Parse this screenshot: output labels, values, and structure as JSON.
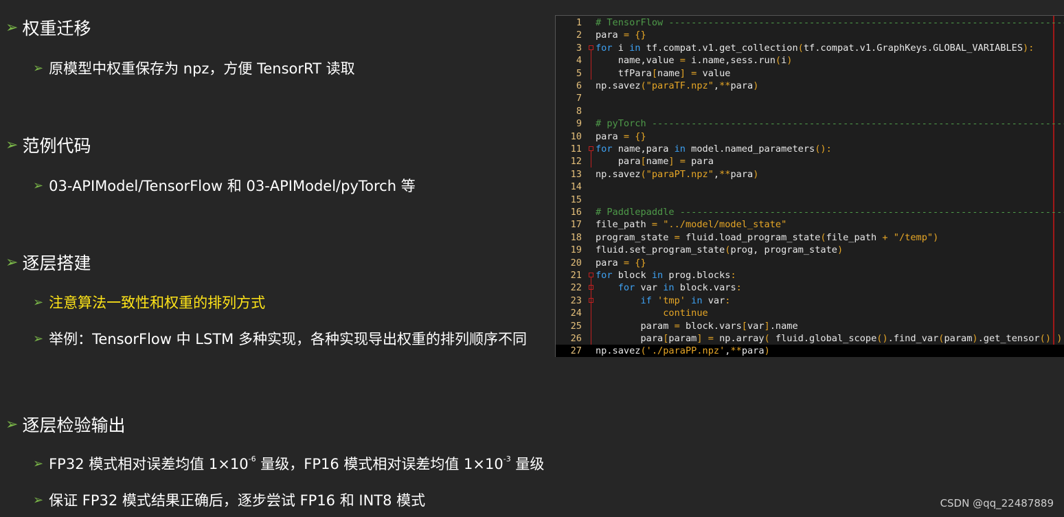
{
  "slide": {
    "sections": [
      {
        "title": "权重迁移",
        "items": [
          {
            "text": "原模型中权重保存为 npz，方便 TensorRT 读取"
          }
        ]
      },
      {
        "title": "范例代码",
        "items": [
          {
            "text": "03-APIModel/TensorFlow 和 03-APIModel/pyTorch 等"
          }
        ]
      },
      {
        "title": "逐层搭建",
        "items": [
          {
            "text": "注意算法一致性和权重的排列方式",
            "color": "#ffe418"
          },
          {
            "text": "举例：TensorFlow 中 LSTM 多种实现，各种实现导出权重的排列顺序不同"
          }
        ]
      },
      {
        "title": "逐层检验输出",
        "items": [
          {
            "parts": [
              "FP32 模式相对误差均值 1×10",
              "-6",
              " 量级，FP16 模式相对误差均值 1×10",
              "-3",
              " 量级"
            ]
          },
          {
            "text": "保证 FP32 模式结果正确后，逐步尝试 FP16 和 INT8 模式"
          }
        ]
      }
    ],
    "bullet_color": "#7ab648",
    "highlight_color": "#ffe418"
  },
  "code": {
    "lines": [
      {
        "n": "1",
        "src": "# TensorFlow -------------------------------------------------------------------------------"
      },
      {
        "n": "2",
        "src": "para = {}"
      },
      {
        "n": "3",
        "src": "for i in tf.compat.v1.get_collection(tf.compat.v1.GraphKeys.GLOBAL_VARIABLES):"
      },
      {
        "n": "4",
        "src": "    name,value = i.name,sess.run(i)"
      },
      {
        "n": "5",
        "src": "    tfPara[name] = value"
      },
      {
        "n": "6",
        "src": "np.savez(\"paraTF.npz\",**para)"
      },
      {
        "n": "7",
        "src": ""
      },
      {
        "n": "8",
        "src": ""
      },
      {
        "n": "9",
        "src": "# pyTorch ----------------------------------------------------------------------------------"
      },
      {
        "n": "10",
        "src": "para = {}"
      },
      {
        "n": "11",
        "src": "for name,para in model.named_parameters():"
      },
      {
        "n": "12",
        "src": "    para[name] = para"
      },
      {
        "n": "13",
        "src": "np.savez(\"paraPT.npz\",**para)"
      },
      {
        "n": "14",
        "src": ""
      },
      {
        "n": "15",
        "src": ""
      },
      {
        "n": "16",
        "src": "# Paddlepaddle -----------------------------------------------------------------------------"
      },
      {
        "n": "17",
        "src": "file_path = \"../model/model_state\""
      },
      {
        "n": "18",
        "src": "program_state = fluid.load_program_state(file_path + \"/temp\")"
      },
      {
        "n": "19",
        "src": "fluid.set_program_state(prog, program_state)"
      },
      {
        "n": "20",
        "src": "para = {}"
      },
      {
        "n": "21",
        "src": "for block in prog.blocks:"
      },
      {
        "n": "22",
        "src": "    for var in block.vars:"
      },
      {
        "n": "23",
        "src": "        if 'tmp' in var:"
      },
      {
        "n": "24",
        "src": "            continue"
      },
      {
        "n": "25",
        "src": "        param = block.vars[var].name"
      },
      {
        "n": "26",
        "src": "        para[param] = np.array( fluid.global_scope().find_var(param).get_tensor() )"
      },
      {
        "n": "27",
        "src": "np.savez('./paraPP.npz',**para)"
      }
    ],
    "fold_markers": [
      "3",
      "11",
      "21",
      "22",
      "23"
    ]
  },
  "watermark": "CSDN @qq_22487889"
}
